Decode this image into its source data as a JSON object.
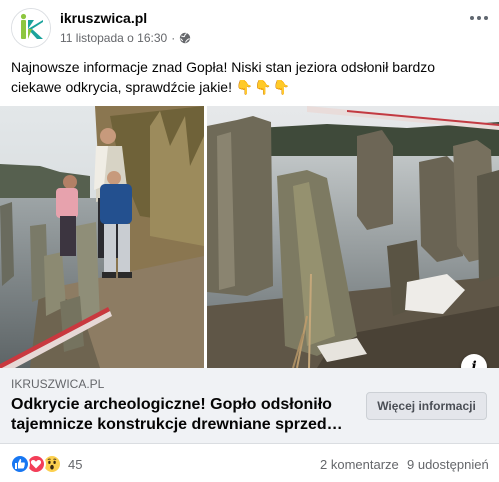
{
  "post": {
    "page_name": "ikruszwica.pl",
    "timestamp": "11 listopada o 16:30",
    "separator": "·",
    "audience_icon": "globe-icon",
    "more_icon": "more-options-icon",
    "text": "Najnowsze informacje znad Gopła! Niski stan jeziora odsłonił bardzo ciekawe odkrycia, sprawdźcie jakie!",
    "emoji": "👇👇👇"
  },
  "avatar": {
    "logo_text": "ik",
    "colors": {
      "green": "#8dc63f",
      "teal": "#1ba39c"
    }
  },
  "link_preview": {
    "domain": "IKRUSZWICA.PL",
    "title": "Odkrycie archeologiczne! Gopło odsłoniło tajemnicze konstrukcje drewniane sprzed…",
    "button_label": "Więcej informacji",
    "info_label": "i"
  },
  "engagement": {
    "reaction_icons": [
      "like-icon",
      "love-icon",
      "wow-icon"
    ],
    "reaction_count": "45",
    "comments": "2 komentarze",
    "shares": "9 udostępnień"
  },
  "colors": {
    "secondary_text": "#65676b",
    "link_box_bg": "#f0f2f5",
    "like": "#1877f2",
    "love": "#f33e58",
    "wow": "#fcd04f"
  }
}
